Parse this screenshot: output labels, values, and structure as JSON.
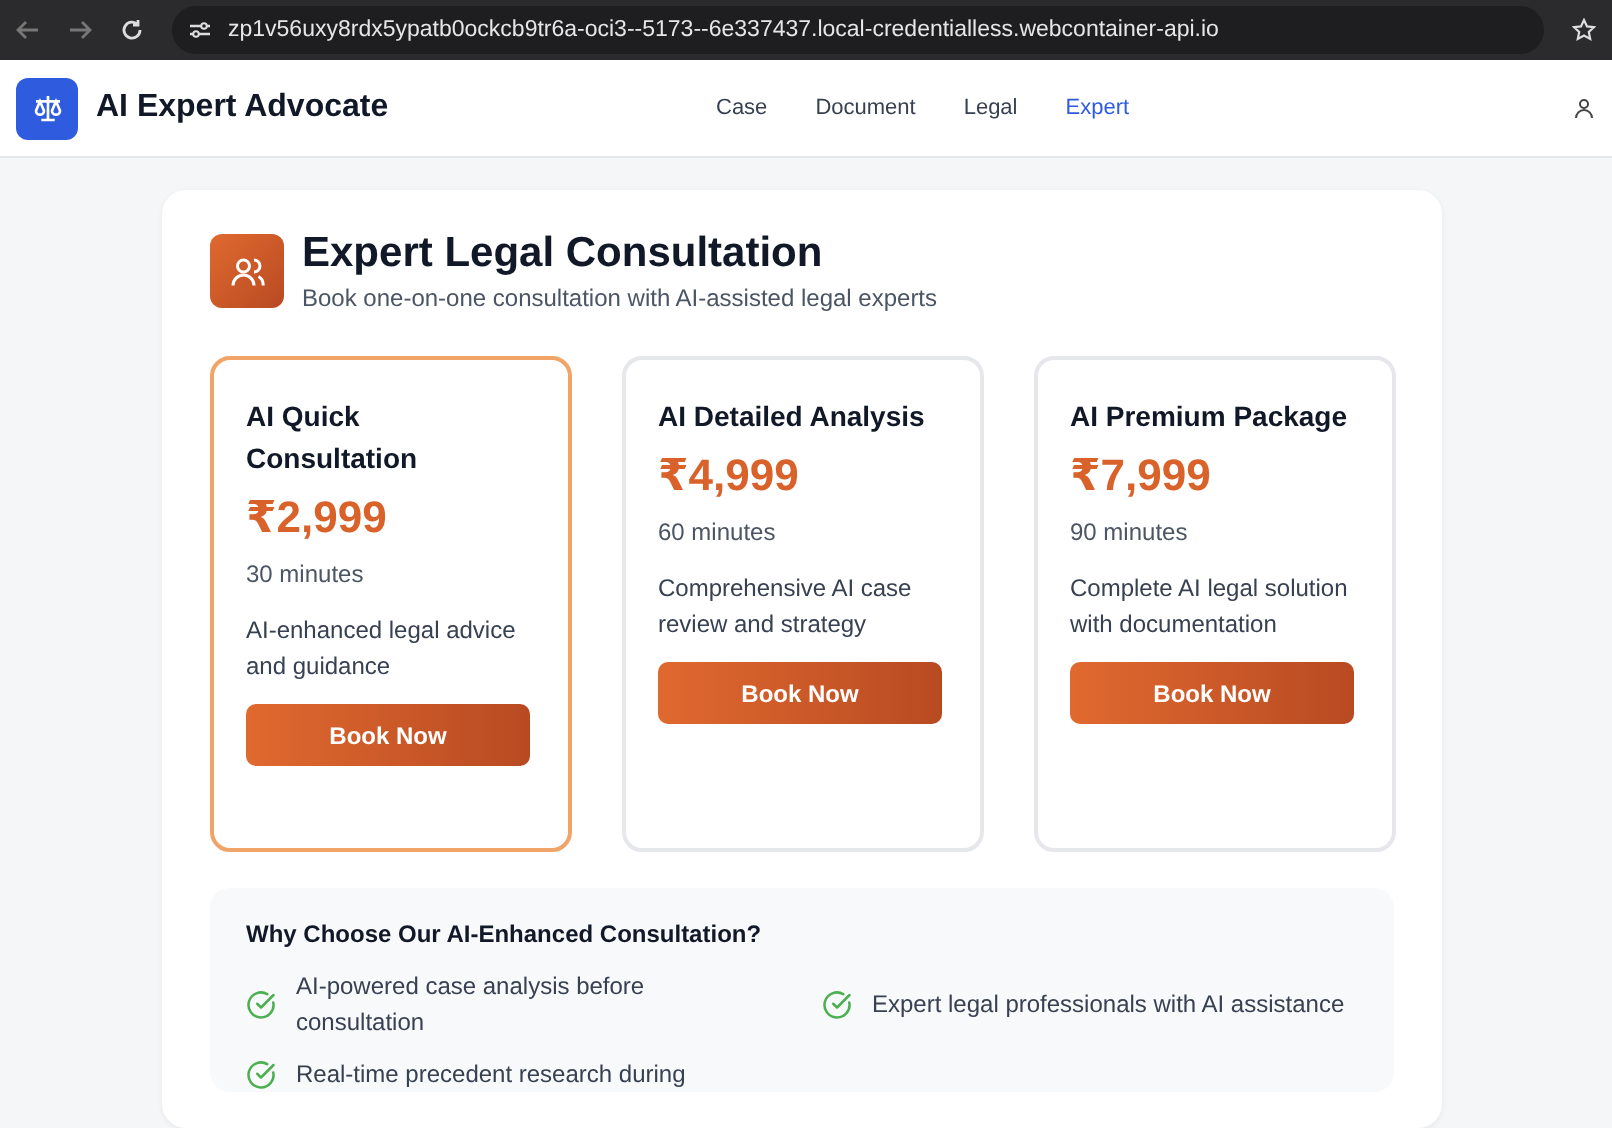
{
  "browser": {
    "url": "zp1v56uxy8rdx5ypatb0ockcb9tr6a-oci3--5173--6e337437.local-credentialless.webcontainer-api.io"
  },
  "header": {
    "brand": "AI Expert Advocate",
    "nav": [
      {
        "label": "Case",
        "selected": false
      },
      {
        "label": "Document",
        "selected": false
      },
      {
        "label": "Legal",
        "selected": false
      },
      {
        "label": "Expert",
        "selected": true
      }
    ]
  },
  "page": {
    "title": "Expert Legal Consultation",
    "subtitle": "Book one-on-one consultation with AI-assisted legal experts"
  },
  "plans": [
    {
      "name": "AI Quick Consultation",
      "price": "₹2,999",
      "duration": "30 minutes",
      "description": "AI-enhanced legal advice and guidance",
      "button": "Book Now",
      "selected": true
    },
    {
      "name": "AI Detailed Analysis",
      "price": "₹4,999",
      "duration": "60 minutes",
      "description": "Comprehensive AI case review and strategy",
      "button": "Book Now",
      "selected": false
    },
    {
      "name": "AI Premium Package",
      "price": "₹7,999",
      "duration": "90 minutes",
      "description": "Complete AI legal solution with documentation",
      "button": "Book Now",
      "selected": false
    }
  ],
  "features": {
    "title": "Why Choose Our AI-Enhanced Consultation?",
    "items": [
      "AI-powered case analysis before consultation",
      "Expert legal professionals with AI assistance",
      "Real-time precedent research during"
    ]
  }
}
